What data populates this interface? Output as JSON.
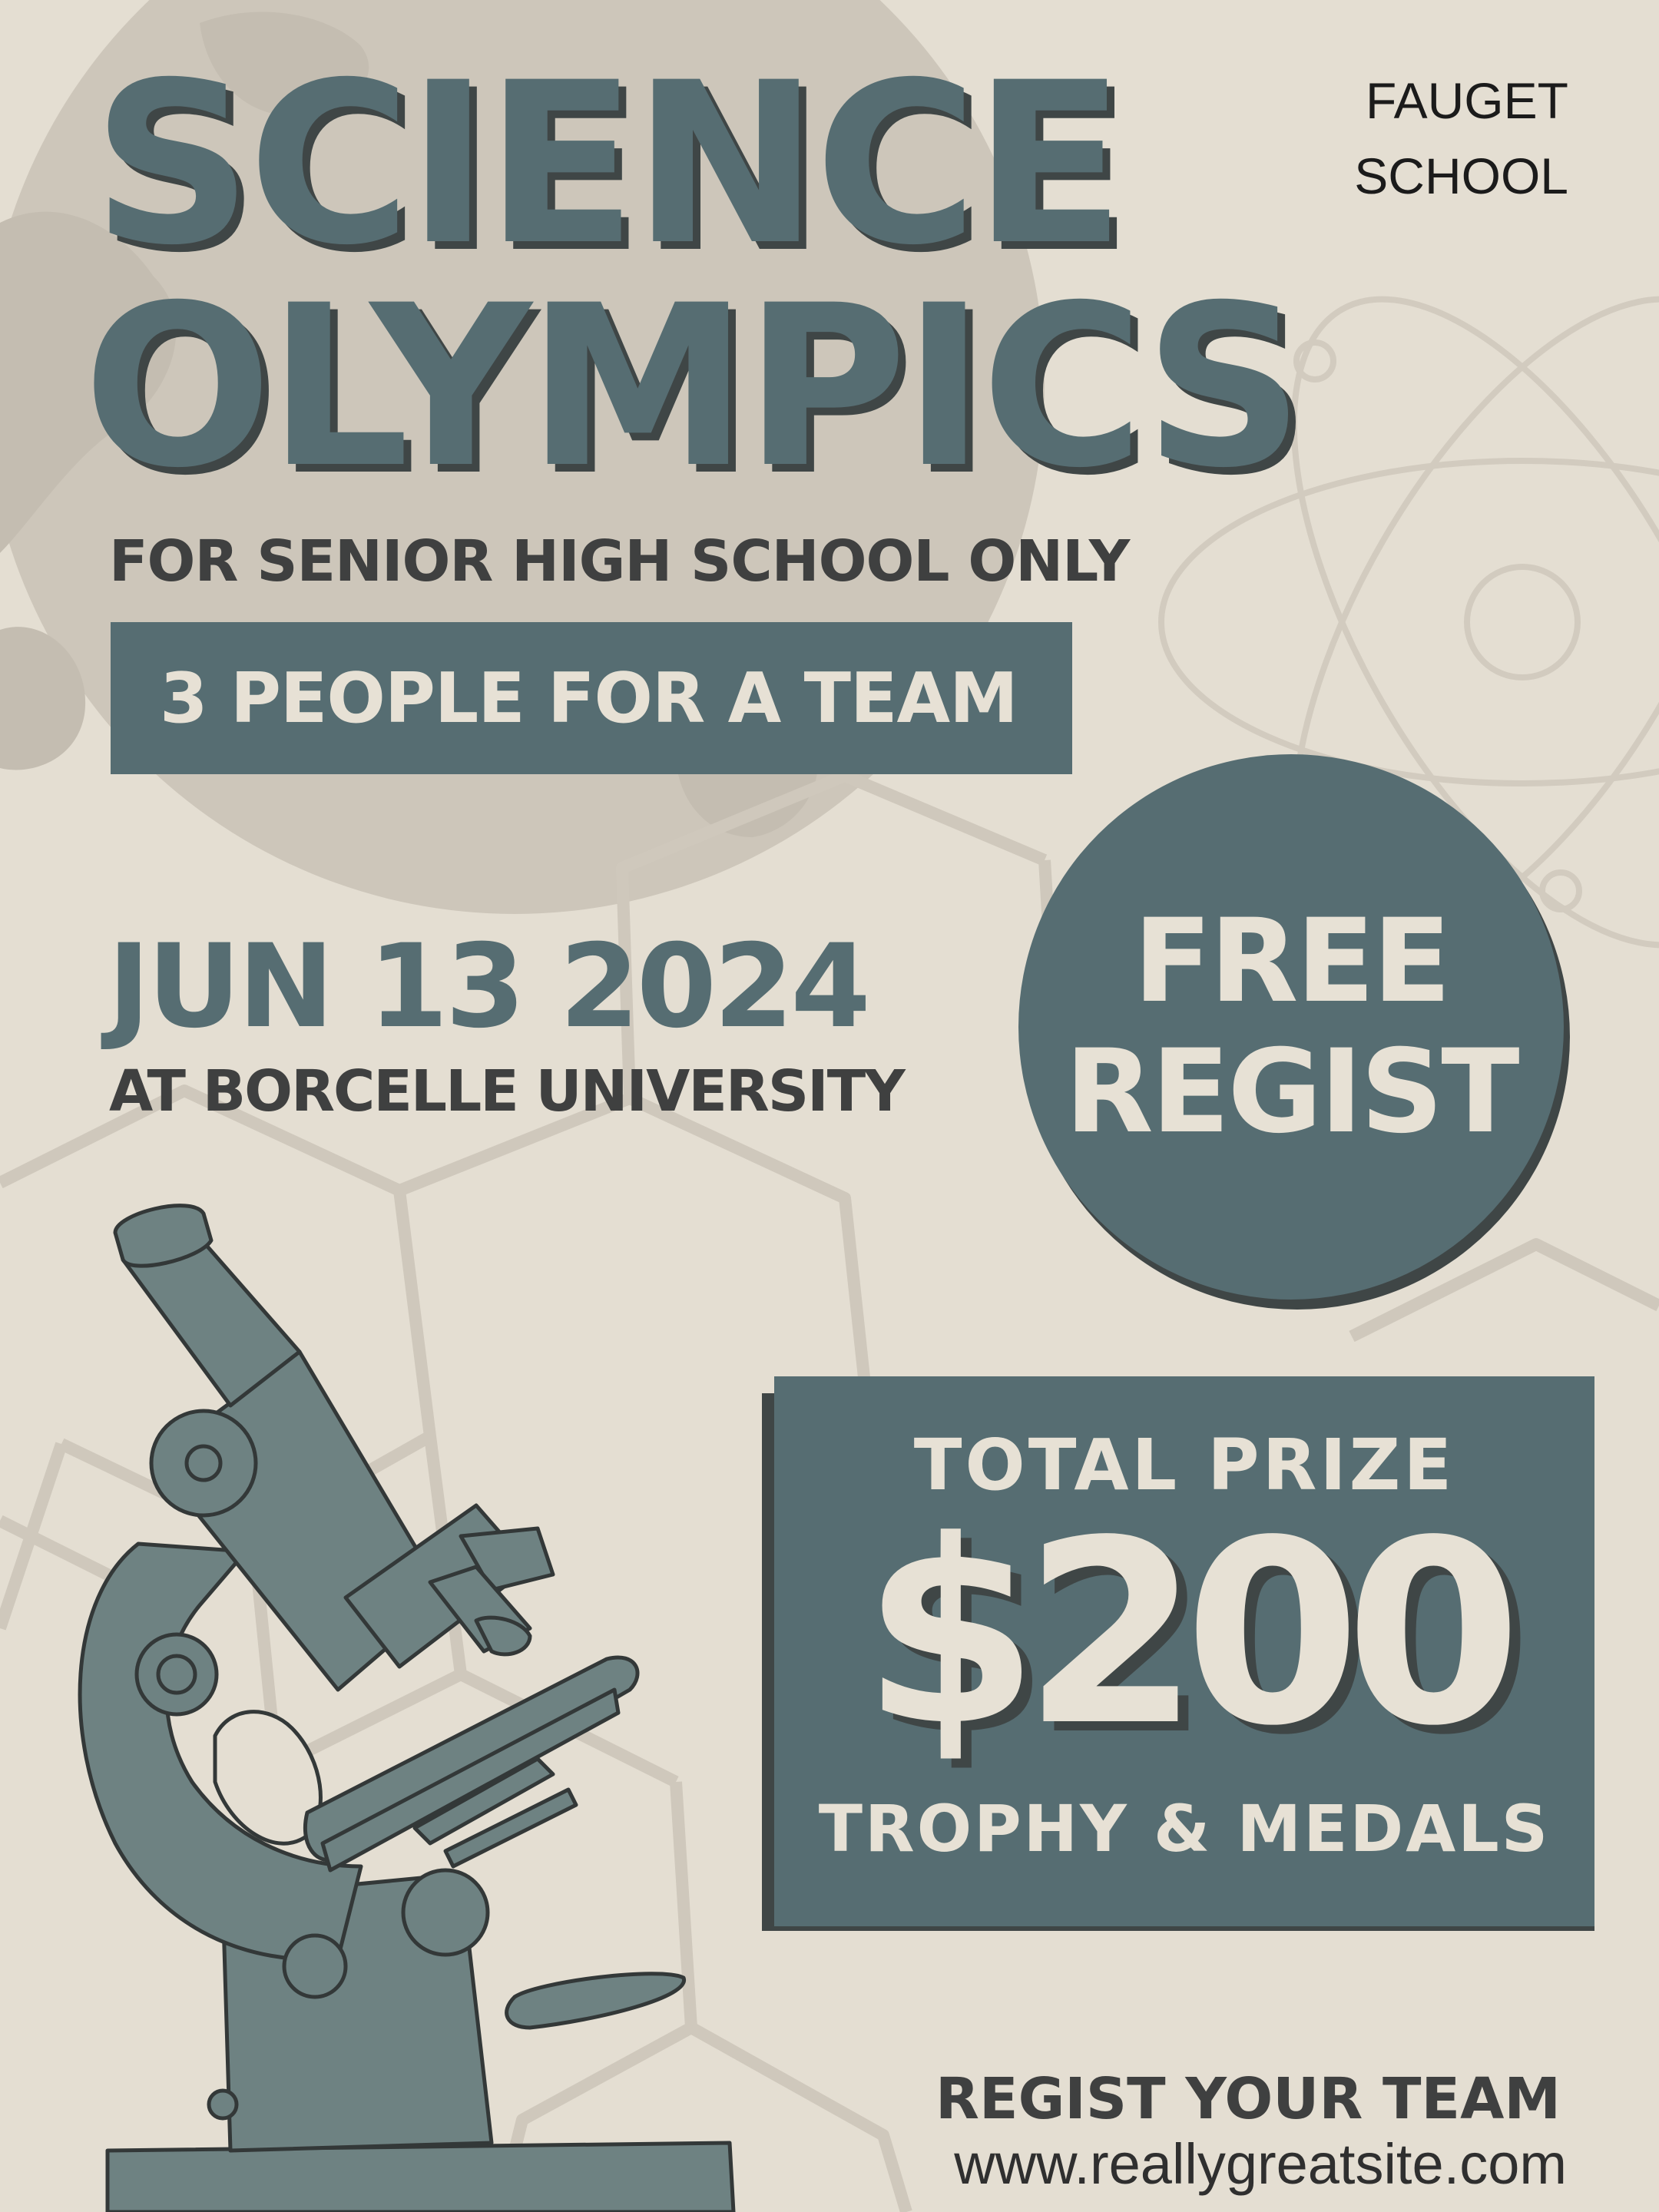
{
  "poster": {
    "title_line1": "SCIENCE",
    "title_line2": "OLYMPICS",
    "school_line1": "FAUGET",
    "school_line2": "SCHOOL",
    "eligibility": "FOR SENIOR HIGH SCHOOL ONLY",
    "team_size": "3 PEOPLE FOR A TEAM",
    "date": "JUN 13 2024",
    "venue": "AT BORCELLE UNIVERSITY",
    "registration_line1": "FREE",
    "registration_line2": "REGIST",
    "prize_label": "TOTAL PRIZE",
    "prize_amount": "$200",
    "prize_extra": "TROPHY & MEDALS",
    "call_to_action": "REGIST YOUR TEAM",
    "website": "www.reallygreatsite.com"
  },
  "colors": {
    "background": "#e4ded2",
    "primary": "#566d72",
    "shadow": "#3f4646",
    "light_text": "#e7e1d5",
    "dark_text": "#3f4040"
  },
  "icons": {
    "globe": "globe-illustration",
    "atom": "atom-icon",
    "molecule": "hexagon-molecule-pattern",
    "microscope": "microscope-illustration"
  }
}
